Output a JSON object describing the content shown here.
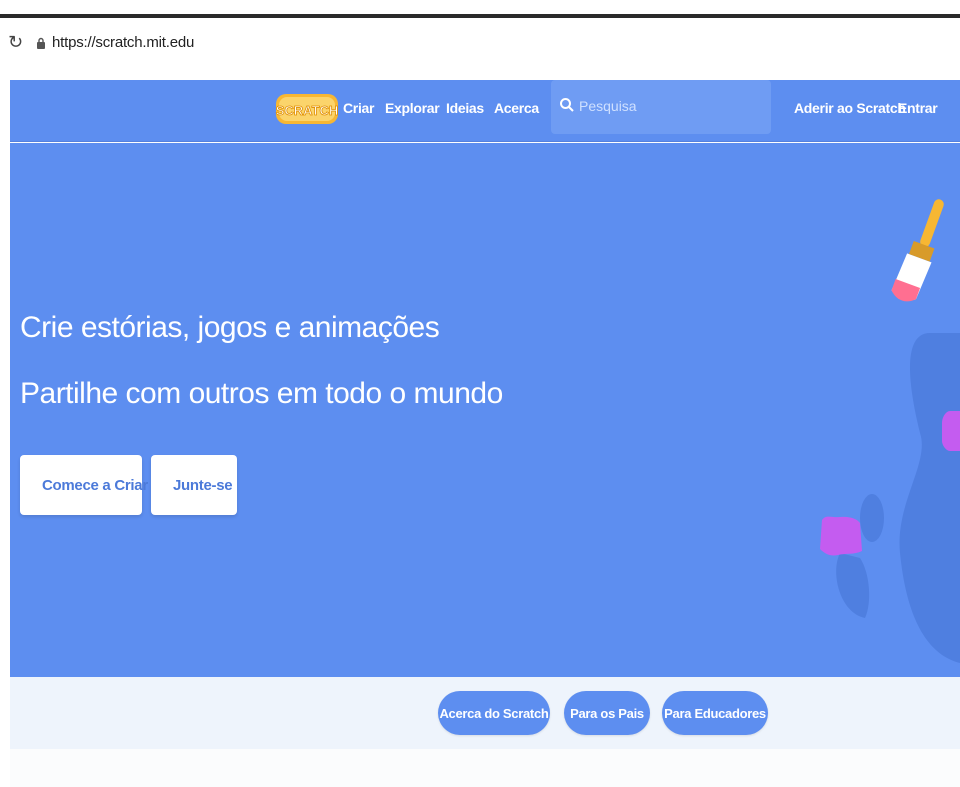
{
  "browser": {
    "url": "https://scratch.mit.edu",
    "reload_icon": "reload-icon",
    "lock_icon": "lock-icon"
  },
  "nav": {
    "logo_text": "SCRATCH",
    "links": [
      "Criar",
      "Explorar",
      "Ideias",
      "Acerca"
    ],
    "search_placeholder": "Pesquisa",
    "join": "Aderir ao Scratch",
    "signin": "Entrar"
  },
  "hero": {
    "title": "Crie estórias, jogos e animações",
    "subtitle": "Partilhe com outros em todo o mundo",
    "start_button": "Comece a Criar",
    "join_button": "Junte-se"
  },
  "subnav": {
    "pills": [
      "Acerca do Scratch",
      "Para os Pais",
      "Para Educadores"
    ]
  },
  "colors": {
    "brand_blue": "#5d8ef0",
    "cta_text": "#4c7ad9",
    "search_bg": "#6f9cf3",
    "accent_yellow": "#f7b733",
    "accent_pink": "#ff6f91",
    "accent_purple": "#c45cf0"
  }
}
